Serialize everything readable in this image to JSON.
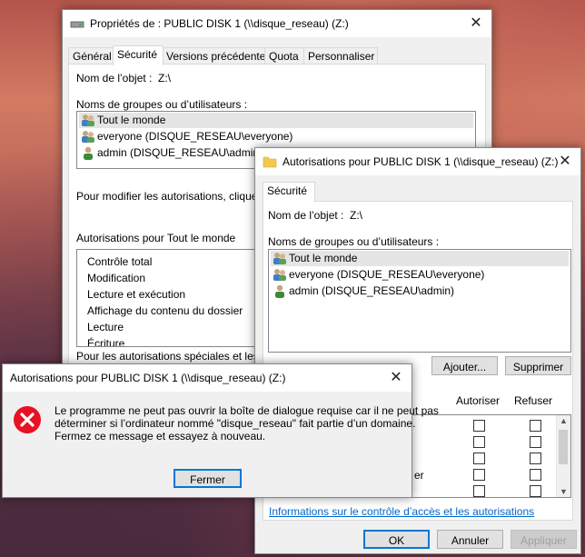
{
  "props": {
    "title": "Propriétés de : PUBLIC DISK 1 (\\\\disque_reseau) (Z:)",
    "tabs": [
      "Général",
      "Sécurité",
      "Versions précédentes",
      "Quota",
      "Personnaliser"
    ],
    "object_label": "Nom de l’objet :",
    "object_value": "Z:\\",
    "groups_label": "Noms de groupes ou d’utilisateurs :",
    "users": [
      "Tout le monde",
      "everyone (DISQUE_RESEAU\\everyone)",
      "admin (DISQUE_RESEAU\\admin)"
    ],
    "modify_hint": "Pour modifier les autorisations, cliquez sur",
    "perms_label": "Autorisations pour Tout le monde",
    "perms": [
      "Contrôle total",
      "Modification",
      "Lecture et exécution",
      "Affichage du contenu du dossier",
      "Lecture",
      "Écriture"
    ],
    "special_hint": "Pour les autorisations spéciales et les para"
  },
  "perm_dialog": {
    "title": "Autorisations pour PUBLIC DISK 1 (\\\\disque_reseau) (Z:)",
    "tab": "Sécurité",
    "object_label": "Nom de l’objet :",
    "object_value": "Z:\\",
    "groups_label": "Noms de groupes ou d’utilisateurs :",
    "users": [
      "Tout le monde",
      "everyone (DISQUE_RESEAU\\everyone)",
      "admin (DISQUE_RESEAU\\admin)"
    ],
    "add_button": "Ajouter...",
    "remove_button": "Supprimer",
    "allow_header": "Autoriser",
    "deny_header": "Refuser",
    "row_fragment": "er",
    "link": "Informations sur le contrôle d’accès et les autorisations",
    "ok_button": "OK",
    "cancel_button": "Annuler",
    "apply_button": "Appliquer"
  },
  "error_dialog": {
    "title": "Autorisations pour PUBLIC DISK 1 (\\\\disque_reseau) (Z:)",
    "message_lines": [
      "Le programme ne peut pas ouvrir la boîte de dialogue requise car il ne peut pas",
      "déterminer si l’ordinateur nommé \"disque_reseau\" fait partie d’un domaine.",
      "Fermez ce message et essayez à nouveau."
    ],
    "close_button": "Fermer"
  },
  "colors": {
    "error_red": "#e81123",
    "accent_blue": "#0078d7",
    "link_blue": "#0066cc"
  },
  "icons": {
    "drive": "drive-icon",
    "folder": "folder-icon",
    "group": "group-users-icon",
    "user": "user-icon",
    "error": "error-icon",
    "close": "close-icon"
  }
}
